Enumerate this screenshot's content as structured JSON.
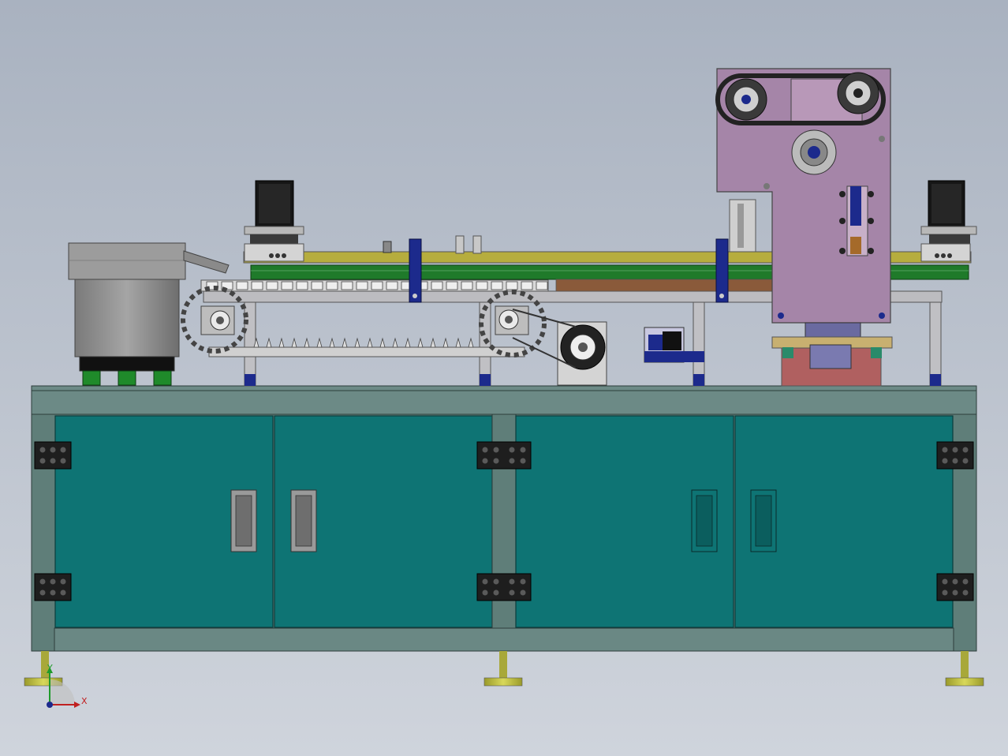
{
  "view": {
    "background_top": "#a9b2c0",
    "background_bottom": "#cfd4dc"
  },
  "colors": {
    "cabinet_door": "#0e7474",
    "cabinet_frame": "#5e7d78",
    "cabinet_top": "#6a8884",
    "hinge": "#1e1e1e",
    "handle": "#9a9a9a",
    "conveyor_yellow": "#b6ad3e",
    "conveyor_green": "#1f7a2a",
    "motor_black": "#161616",
    "bracket_blue": "#1c2a8c",
    "head_purple": "#a585a8",
    "bowl_gray": "#8e8e8e",
    "foot_green": "#1f8a2a",
    "leveling_foot": "#b8b83a",
    "frame_gray": "#b9b9bd",
    "fixture_red": "#b06060",
    "fixture_yellow": "#c8b070"
  },
  "triad": {
    "x_label": "X",
    "y_label": "Y"
  },
  "icons": {
    "coordinate_triad": "axis-triad-icon",
    "stepper_motor": "stepper-motor-icon",
    "hinge": "hinge-icon",
    "door_handle": "door-handle-icon",
    "pulley": "pulley-icon"
  }
}
